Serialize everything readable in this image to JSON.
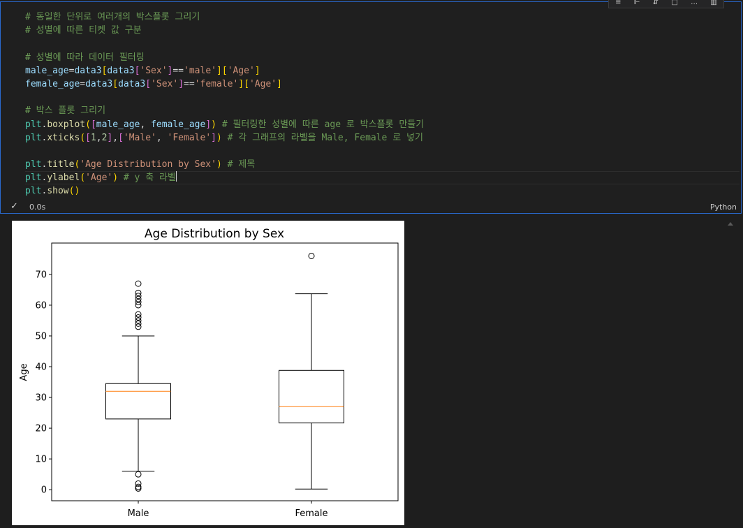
{
  "cell": {
    "toolbar_icons": [
      "run-above-icon",
      "run-below-icon",
      "split-icon",
      "more-icon",
      "delete-icon"
    ],
    "lines": [
      [
        [
          "t-cmt",
          "# 동일한 단위로 여러개의 박스플롯 그리기"
        ]
      ],
      [
        [
          "t-cmt",
          "# 성별에 따른 티켓 값 구분"
        ]
      ],
      [],
      [
        [
          "t-cmt",
          "# 성별에 따라 데이터 필터링"
        ]
      ],
      [
        [
          "t-var",
          "male_age"
        ],
        [
          "t-op",
          "="
        ],
        [
          "t-var",
          "data3"
        ],
        [
          "t-b1",
          "["
        ],
        [
          "t-var",
          "data3"
        ],
        [
          "t-b2",
          "["
        ],
        [
          "t-str",
          "'Sex'"
        ],
        [
          "t-b2",
          "]"
        ],
        [
          "t-op",
          "=="
        ],
        [
          "t-str",
          "'male'"
        ],
        [
          "t-b1",
          "]"
        ],
        [
          "t-b1",
          "["
        ],
        [
          "t-str",
          "'Age'"
        ],
        [
          "t-b1",
          "]"
        ]
      ],
      [
        [
          "t-var",
          "female_age"
        ],
        [
          "t-op",
          "="
        ],
        [
          "t-var",
          "data3"
        ],
        [
          "t-b1",
          "["
        ],
        [
          "t-var",
          "data3"
        ],
        [
          "t-b2",
          "["
        ],
        [
          "t-str",
          "'Sex'"
        ],
        [
          "t-b2",
          "]"
        ],
        [
          "t-op",
          "=="
        ],
        [
          "t-str",
          "'female'"
        ],
        [
          "t-b1",
          "]"
        ],
        [
          "t-b1",
          "["
        ],
        [
          "t-str",
          "'Age'"
        ],
        [
          "t-b1",
          "]"
        ]
      ],
      [],
      [
        [
          "t-cmt",
          "# 박스 플롯 그리기"
        ]
      ],
      [
        [
          "t-plt",
          "plt"
        ],
        [
          "t-op",
          "."
        ],
        [
          "t-fn",
          "boxplot"
        ],
        [
          "t-b1",
          "("
        ],
        [
          "t-b2",
          "["
        ],
        [
          "t-var",
          "male_age"
        ],
        [
          "t-op",
          ", "
        ],
        [
          "t-var",
          "female_age"
        ],
        [
          "t-b2",
          "]"
        ],
        [
          "t-b1",
          ")"
        ],
        [
          "t-op",
          " "
        ],
        [
          "t-cmt",
          "# 필터링한 성별에 따른 age 로 박스플롯 만들기"
        ]
      ],
      [
        [
          "t-plt",
          "plt"
        ],
        [
          "t-op",
          "."
        ],
        [
          "t-fn",
          "xticks"
        ],
        [
          "t-b1",
          "("
        ],
        [
          "t-b2",
          "["
        ],
        [
          "t-num",
          "1"
        ],
        [
          "t-op",
          ","
        ],
        [
          "t-num",
          "2"
        ],
        [
          "t-b2",
          "]"
        ],
        [
          "t-op",
          ","
        ],
        [
          "t-b2",
          "["
        ],
        [
          "t-str",
          "'Male'"
        ],
        [
          "t-op",
          ", "
        ],
        [
          "t-str",
          "'Female'"
        ],
        [
          "t-b2",
          "]"
        ],
        [
          "t-b1",
          ")"
        ],
        [
          "t-op",
          " "
        ],
        [
          "t-cmt",
          "# 각 그래프의 라벨을 Male, Female 로 넣기"
        ]
      ],
      [],
      [
        [
          "t-plt",
          "plt"
        ],
        [
          "t-op",
          "."
        ],
        [
          "t-fn",
          "title"
        ],
        [
          "t-b1",
          "("
        ],
        [
          "t-str",
          "'Age Distribution by Sex'"
        ],
        [
          "t-b1",
          ")"
        ],
        [
          "t-op",
          " "
        ],
        [
          "t-cmt",
          "# 제목"
        ]
      ],
      [
        [
          "t-plt",
          "plt"
        ],
        [
          "t-op",
          "."
        ],
        [
          "t-fn",
          "ylabel"
        ],
        [
          "t-b1",
          "("
        ],
        [
          "t-str",
          "'Age'"
        ],
        [
          "t-b1",
          ")"
        ],
        [
          "t-op",
          " "
        ],
        [
          "t-cmt",
          "# y 축 라벨"
        ]
      ],
      [
        [
          "t-plt",
          "plt"
        ],
        [
          "t-op",
          "."
        ],
        [
          "t-fn",
          "show"
        ],
        [
          "t-b1",
          "()"
        ]
      ]
    ],
    "cursor_line": 12
  },
  "status": {
    "check_icon": "check-icon",
    "exec_time": "0.0s",
    "language": "Python"
  },
  "chart_data": {
    "type": "boxplot",
    "title": "Age Distribution by Sex",
    "xlabel": "",
    "ylabel": "Age",
    "ylim": [
      -3.6,
      80.2
    ],
    "yticks": [
      0,
      10,
      20,
      30,
      40,
      50,
      60,
      70
    ],
    "categories": [
      "Male",
      "Female"
    ],
    "positions": [
      1,
      2
    ],
    "boxes": [
      {
        "name": "Male",
        "whisker_low": 6,
        "q1": 23,
        "median": 32,
        "q3": 34.5,
        "whisker_high": 50,
        "outliers": [
          0.4,
          0.9,
          2,
          5,
          53,
          54,
          55,
          56,
          57,
          60,
          61,
          62,
          63,
          64,
          67
        ]
      },
      {
        "name": "Female",
        "whisker_low": 0.2,
        "q1": 21.7,
        "median": 27,
        "q3": 38.8,
        "whisker_high": 63.7,
        "outliers": [
          76
        ]
      }
    ],
    "colors": {
      "box": "#000000",
      "median": "#ff7f0e"
    },
    "grid": false
  }
}
